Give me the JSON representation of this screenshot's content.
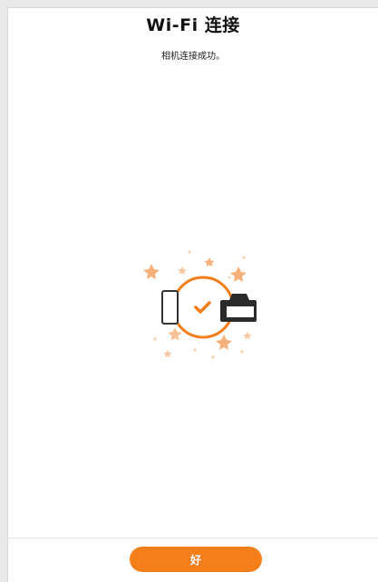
{
  "screen": {
    "title": "Wi-Fi 连接",
    "message": "相机连接成功。"
  },
  "illustration": {
    "icon": "connection-success-illustration",
    "left_device_icon": "phone-icon",
    "center_icon": "checkmark-circle-icon",
    "right_device_icon": "camera-icon",
    "accent_color": "#f47e1a"
  },
  "footer": {
    "ok_label": "好"
  }
}
